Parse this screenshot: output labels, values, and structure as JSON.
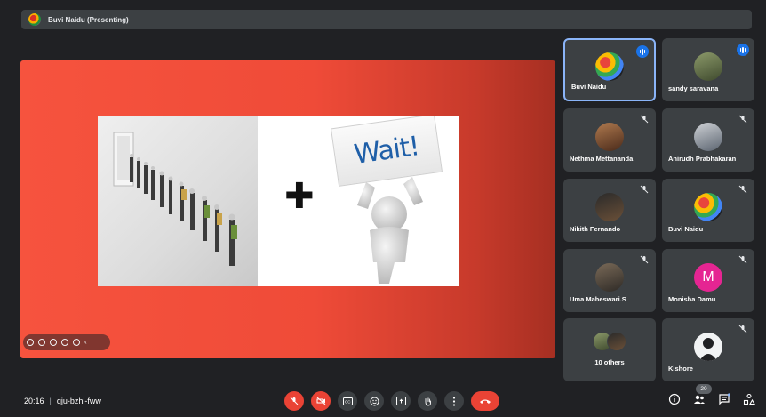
{
  "presenter_bar": {
    "label": "Buvi Naidu (Presenting)"
  },
  "slide": {
    "sign_text": "Wait!"
  },
  "participants": [
    {
      "name": "Buvi Naidu",
      "state": "speaking",
      "active": true
    },
    {
      "name": "sandy saravana",
      "state": "speaking"
    },
    {
      "name": "Nethma Mettananda",
      "state": "muted"
    },
    {
      "name": "Anirudh Prabhakaran",
      "state": "muted"
    },
    {
      "name": "Nikith Fernando",
      "state": "muted"
    },
    {
      "name": "Buvi Naidu",
      "state": "muted"
    },
    {
      "name": "Uma Maheswari.S",
      "state": "muted"
    },
    {
      "name": "Monisha Damu",
      "state": "muted",
      "initial": "M"
    },
    {
      "name": "10 others"
    },
    {
      "name": "Kishore",
      "state": "muted"
    }
  ],
  "meeting": {
    "time": "20:16",
    "code": "qju-bzhi-fww"
  },
  "controls": [
    "mic-off-icon",
    "camera-off-icon",
    "captions-icon",
    "emoji-icon",
    "present-icon",
    "raise-hand-icon",
    "more-icon",
    "hangup-icon"
  ],
  "right_controls": {
    "people_count": "20"
  },
  "colors": {
    "accent": "#1a73e8",
    "danger": "#ea4335",
    "surface": "#3c4043",
    "background": "#202124"
  }
}
